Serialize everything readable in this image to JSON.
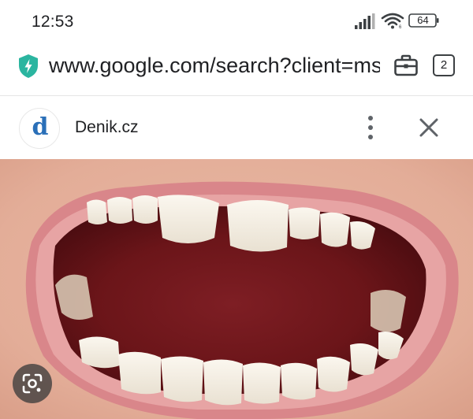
{
  "status_bar": {
    "time": "12:53",
    "battery": "64",
    "icons": [
      "signal-icon",
      "wifi-icon",
      "battery-icon"
    ]
  },
  "browser": {
    "url": "www.google.com/search?client=ms",
    "tab_count": "2",
    "icons": [
      "security-shield-icon",
      "briefcase-icon",
      "tab-switcher-icon"
    ],
    "accent_color": "#2bb5a0"
  },
  "site": {
    "name": "Denik.cz",
    "favicon_letter": "d",
    "favicon_color": "#2a6fb8",
    "icons": [
      "more-vert-icon",
      "close-icon"
    ]
  },
  "image": {
    "subject": "open-mouth-teeth-photo",
    "icons": [
      "google-lens-icon"
    ]
  }
}
